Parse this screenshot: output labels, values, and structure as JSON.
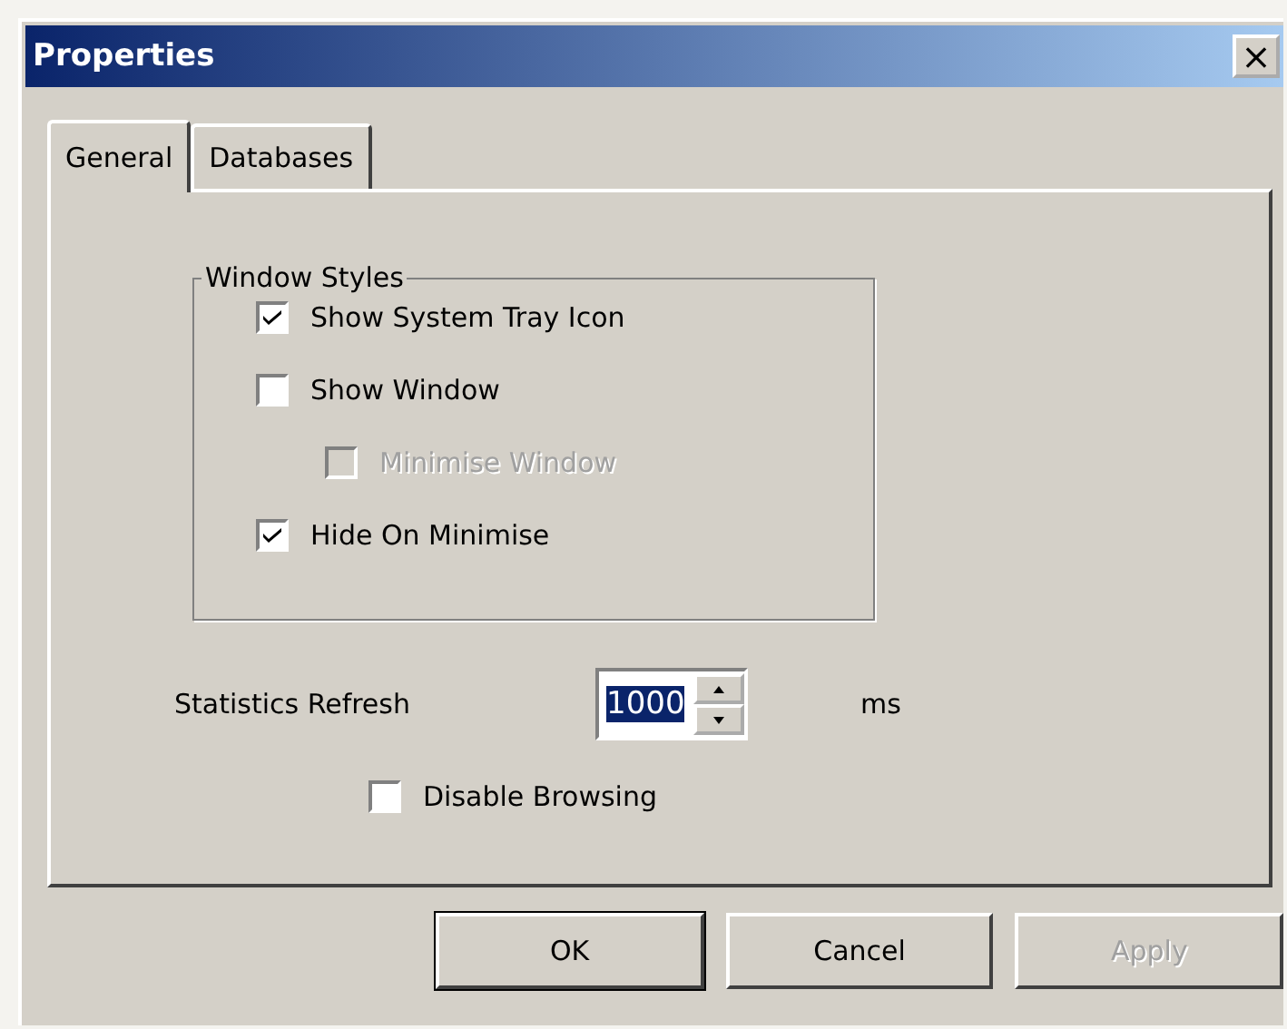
{
  "window": {
    "title": "Properties",
    "close_glyph": "×"
  },
  "tabs": [
    {
      "label": "General",
      "selected": true
    },
    {
      "label": "Databases",
      "selected": false
    }
  ],
  "group": {
    "title": "Window Styles",
    "options": [
      {
        "label": "Show System Tray Icon",
        "checked": true,
        "disabled": false
      },
      {
        "label": "Show Window",
        "checked": false,
        "disabled": false,
        "children": [
          {
            "label": "Minimise Window",
            "checked": false,
            "disabled": true
          }
        ]
      },
      {
        "label": "Hide On Minimise",
        "checked": true,
        "disabled": false
      }
    ]
  },
  "refresh": {
    "label": "Statistics Refresh",
    "value": "1000",
    "unit": "ms"
  },
  "disable_browsing": {
    "label": "Disable Browsing",
    "checked": false,
    "disabled": false
  },
  "buttons": [
    {
      "label": "OK",
      "default": true,
      "disabled": false
    },
    {
      "label": "Cancel",
      "default": false,
      "disabled": false
    },
    {
      "label": "Apply",
      "default": false,
      "disabled": true
    }
  ]
}
